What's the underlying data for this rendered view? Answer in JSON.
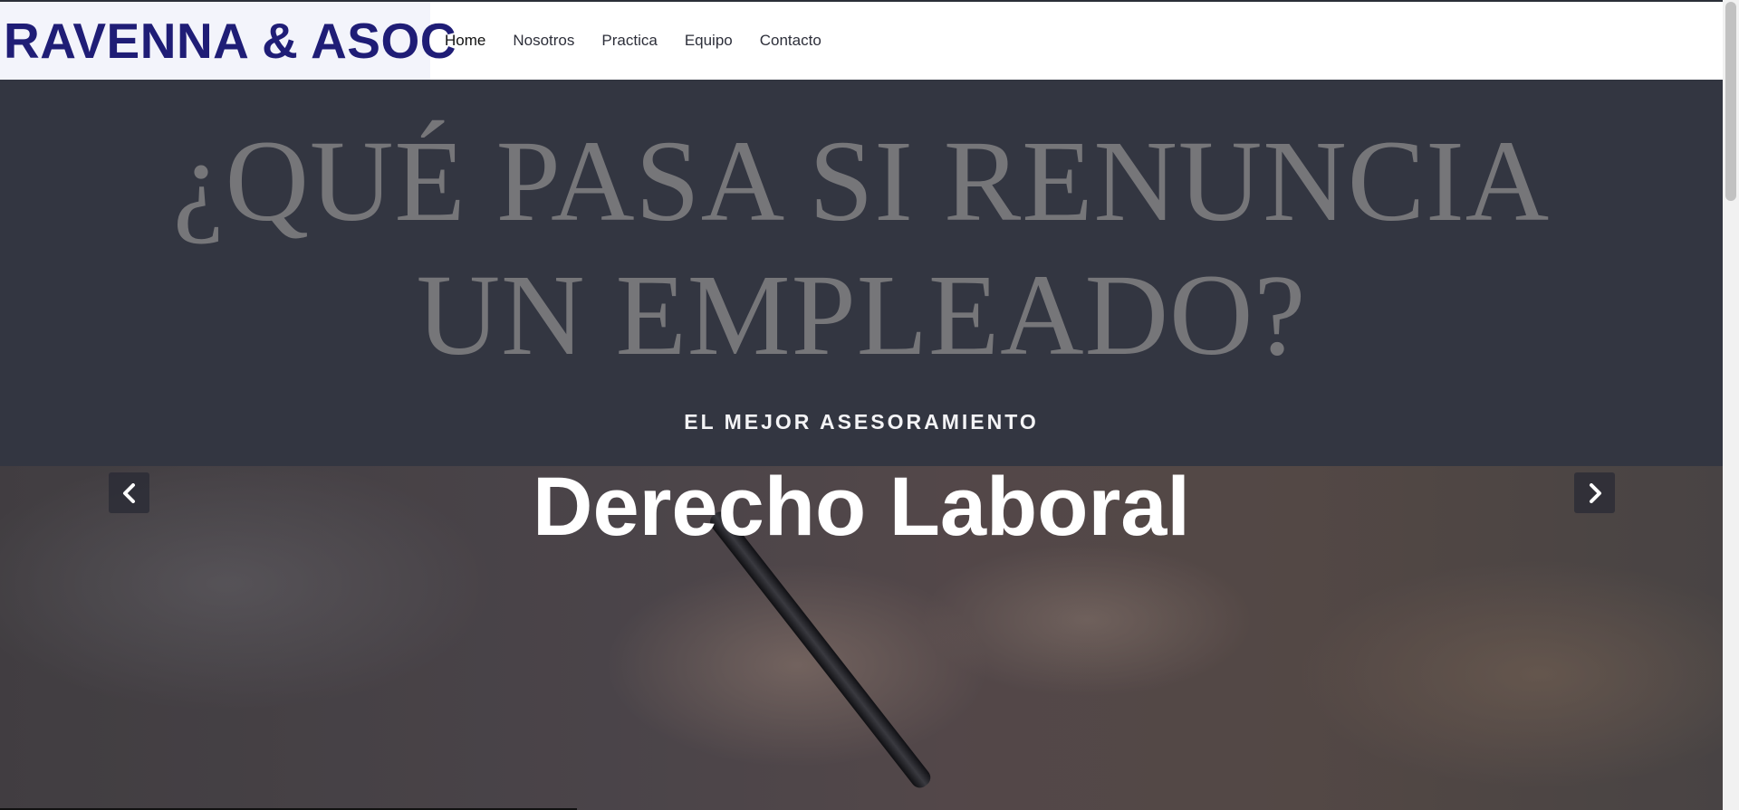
{
  "brand": {
    "name": "RAVENNA & ASOC",
    "color": "#1f1d76"
  },
  "nav": {
    "items": [
      {
        "label": "Home"
      },
      {
        "label": "Nosotros"
      },
      {
        "label": "Practica"
      },
      {
        "label": "Equipo"
      },
      {
        "label": "Contacto"
      }
    ]
  },
  "hero": {
    "image_text_line1": "¿QUÉ PASA SI RENUNCIA",
    "image_text_line2": "UN EMPLEADO?",
    "kicker": "EL MEJOR ASESORAMIENTO",
    "title": "Derecho Laboral",
    "prev_icon": "chevron-left-icon",
    "next_icon": "chevron-right-icon"
  }
}
